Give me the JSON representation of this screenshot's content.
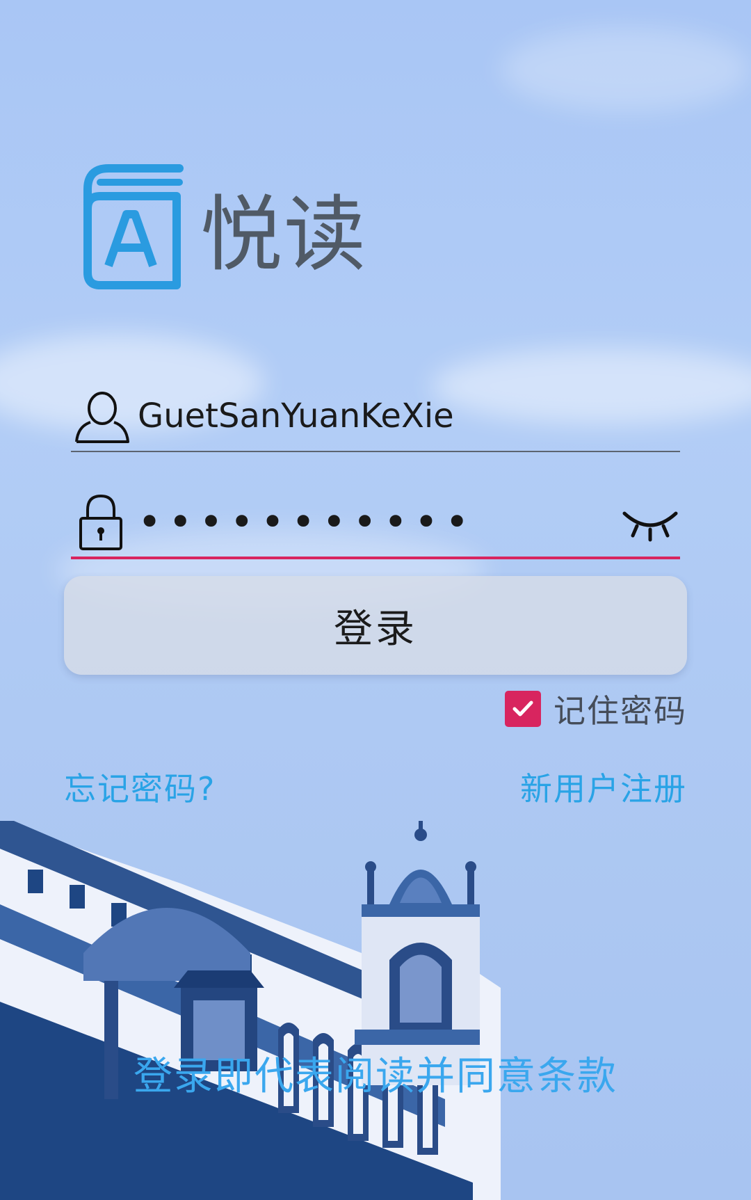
{
  "app": {
    "title": "悦读",
    "logo_icon": "book-a-icon"
  },
  "login_form": {
    "username": {
      "icon": "user-icon",
      "value": "GuetSanYuanKeXie"
    },
    "password": {
      "icon": "lock-icon",
      "value": "•••••••••••",
      "visibility_toggle_icon": "eye-closed-icon"
    },
    "login_button_label": "登录",
    "remember_password": {
      "label": "记住密码",
      "checked": true
    },
    "forgot_password_link": "忘记密码?",
    "register_link": "新用户注册",
    "terms_text": "登录即代表阅读并同意条款"
  },
  "colors": {
    "accent_pink": "#d8255f",
    "link_blue": "#29a3e6",
    "logo_blue": "#2a9be0"
  }
}
